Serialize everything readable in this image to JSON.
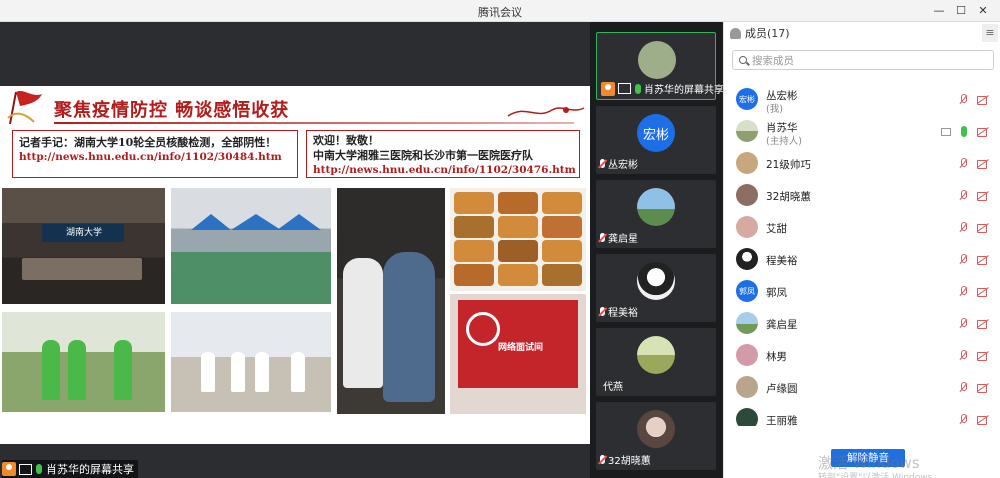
{
  "window": {
    "title": "腾讯会议",
    "controls": [
      "—",
      "☐",
      "✕"
    ]
  },
  "stage": {
    "slide": {
      "title": "聚焦疫情防控 畅谈感悟收获",
      "box1": {
        "text": "记者手记：湖南大学10轮全员核酸检测，全部阴性！",
        "url": "http://news.hnu.edu.cn/info/1102/30484.htm"
      },
      "box2": {
        "line1": "欢迎！致敬！",
        "line2": "中南大学湘雅三医院和长沙市第一医院医疗队",
        "url": "http://news.hnu.edu.cn/info/1102/30476.htm"
      },
      "photo_meeting_label": "湖南大学",
      "photo_room_label": "网络面试间"
    },
    "share_caption": "肖苏华的屏幕共享"
  },
  "thumbnails": [
    {
      "name": "肖苏华的屏幕共享",
      "type": "share",
      "active": true
    },
    {
      "name": "丛宏彬",
      "type": "text",
      "avatar_text": "宏彬",
      "color": "#1c6fe6"
    },
    {
      "name": "龚启星",
      "type": "photo",
      "color": "#6fa7d6"
    },
    {
      "name": "程美裕",
      "type": "photo",
      "color": "#f1f1f1"
    },
    {
      "name": "代燕",
      "type": "photo",
      "color": "#b7c47a"
    },
    {
      "name": "32胡晓蕙",
      "type": "photo",
      "color": "#c9b2a6"
    }
  ],
  "panel": {
    "title": "成员(17)",
    "search_placeholder": "搜索成员",
    "members": [
      {
        "name": "丛宏彬",
        "sub": "(我)",
        "avatar_text": "宏彬",
        "color": "#1c6fe6",
        "state": "muted"
      },
      {
        "name": "肖苏华",
        "sub": "(主持人)",
        "avatar_text": "",
        "color": "#9fae8a",
        "state": "host"
      },
      {
        "name": "21级帅巧",
        "sub": "",
        "avatar_text": "",
        "color": "#c8a77e",
        "state": "muted"
      },
      {
        "name": "32胡晓蕙",
        "sub": "",
        "avatar_text": "",
        "color": "#8d6e63",
        "state": "muted"
      },
      {
        "name": "艾甜",
        "sub": "",
        "avatar_text": "",
        "color": "#d7a9a0",
        "state": "muted"
      },
      {
        "name": "程美裕",
        "sub": "",
        "avatar_text": "",
        "color": "#333333",
        "state": "muted"
      },
      {
        "name": "郭凤",
        "sub": "",
        "avatar_text": "郭凤",
        "color": "#1c6fe6",
        "state": "muted"
      },
      {
        "name": "龚启星",
        "sub": "",
        "avatar_text": "",
        "color": "#7fb3d9",
        "state": "muted"
      },
      {
        "name": "林男",
        "sub": "",
        "avatar_text": "",
        "color": "#d49aa7",
        "state": "muted"
      },
      {
        "name": "卢缘圆",
        "sub": "",
        "avatar_text": "",
        "color": "#b9a48c",
        "state": "muted"
      },
      {
        "name": "王丽雅",
        "sub": "",
        "avatar_text": "",
        "color": "#2c4a3a",
        "state": "muted"
      }
    ],
    "unmute_button": "解除静音"
  },
  "watermark": {
    "line1": "激活 Windows",
    "line2": "转到\"设置\"以激活 Windows。"
  }
}
